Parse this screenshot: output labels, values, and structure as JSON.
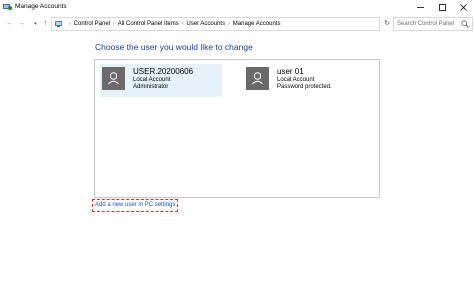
{
  "window": {
    "title": "Manage Accounts"
  },
  "address": {
    "breadcrumbs": [
      "Control Panel",
      "All Control Panel Items",
      "User Accounts",
      "Manage Accounts"
    ],
    "search_placeholder": "Search Control Panel"
  },
  "main": {
    "heading": "Choose the user you would like to change",
    "accounts": [
      {
        "name": "USER.20200606",
        "type": "Local Account",
        "status": "Administrator",
        "selected": true
      },
      {
        "name": "user 01",
        "type": "Local Account",
        "status": "Password protected.",
        "selected": false
      }
    ],
    "add_user_link": "Add a new user in PC settings"
  },
  "colors": {
    "heading": "#1e3d91",
    "link": "#1a52c4",
    "selection": "#e5f1fb",
    "highlight_border": "#d32f2f"
  }
}
